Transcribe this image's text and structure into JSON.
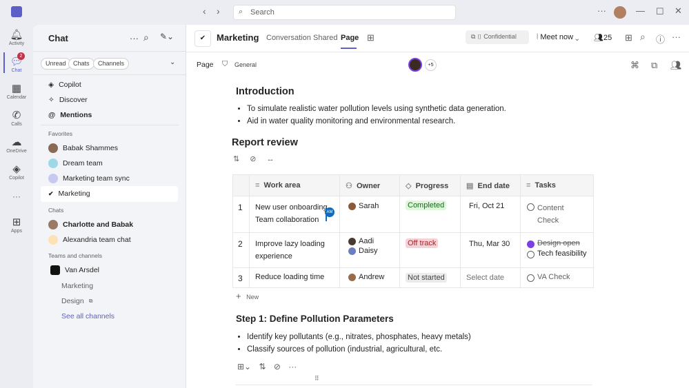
{
  "titlebar": {
    "search_placeholder": "Search"
  },
  "rail": [
    {
      "label": "Activity",
      "icon": "bell-icon"
    },
    {
      "label": "Chat",
      "icon": "chat-icon",
      "badge": "2"
    },
    {
      "label": "Calendar",
      "icon": "calendar-icon"
    },
    {
      "label": "Calls",
      "icon": "phone-icon"
    },
    {
      "label": "OneDrive",
      "icon": "cloud-icon"
    },
    {
      "label": "Copilot",
      "icon": "copilot-icon"
    },
    {
      "label": "Apps",
      "icon": "apps-icon"
    }
  ],
  "chat": {
    "title": "Chat",
    "filters": [
      "Unread",
      "Chats",
      "Channels"
    ],
    "top": [
      "Copilot",
      "Discover",
      "Mentions"
    ],
    "favorites_label": "Favorites",
    "favorites": [
      "Babak Shammes",
      "Dream team",
      "Marketing team sync",
      "Marketing"
    ],
    "chats_label": "Chats",
    "chats": [
      "Charlotte and Babak",
      "Alexandria team chat"
    ],
    "teams_label": "Teams and channels",
    "team": "Van Arsdel",
    "channels": [
      "Marketing",
      "Design"
    ],
    "see_all": "See all channels"
  },
  "header": {
    "title": "Marketing",
    "tabs": [
      "Conversation",
      "Shared",
      "Page"
    ],
    "sensitivity": "Confidential",
    "meet": "Meet now",
    "participants": "25"
  },
  "subheader": {
    "page": "Page",
    "channel": "General",
    "extra": "+5"
  },
  "doc": {
    "intro_title": "Introduction",
    "intro": [
      "To simulate realistic water pollution levels using synthetic data generation.",
      "Aid in water quality monitoring and environmental research."
    ],
    "review_title": "Report review",
    "columns": [
      "Work area",
      "Owner",
      "Progress",
      "End date",
      "Tasks"
    ],
    "rows": [
      {
        "n": "1",
        "work": "New user onboarding Team collaboration",
        "owners": [
          "Sarah"
        ],
        "progress": "Completed",
        "date": "Fri, Oct 21",
        "tasks": [
          {
            "t": "Content Check",
            "done": false
          }
        ]
      },
      {
        "n": "2",
        "work": "Improve lazy loading experience",
        "owners": [
          "Aadi",
          "Daisy"
        ],
        "progress": "Off track",
        "date": "Thu, Mar 30",
        "tasks": [
          {
            "t": "Design open",
            "done": true
          },
          {
            "t": "Tech feasibility",
            "done": false
          }
        ]
      },
      {
        "n": "3",
        "work": "Reduce loading time",
        "owners": [
          "Andrew"
        ],
        "progress": "Not started",
        "date": "Select date",
        "tasks": [
          {
            "t": "VA Check",
            "done": false
          }
        ]
      }
    ],
    "cursor_initials": "AM",
    "new_label": "New",
    "step_title": "Step 1: Define Pollution Parameters",
    "step": [
      "Identify key pollutants (e.g., nitrates, phosphates, heavy metals)",
      "Classify sources of pollution (industrial, agricultural, etc."
    ]
  },
  "colors": {
    "accent": "#5b5fc7",
    "completed": "#dff6dd",
    "offtrack": "#fde7e9",
    "notstarted": "#ebebeb"
  }
}
